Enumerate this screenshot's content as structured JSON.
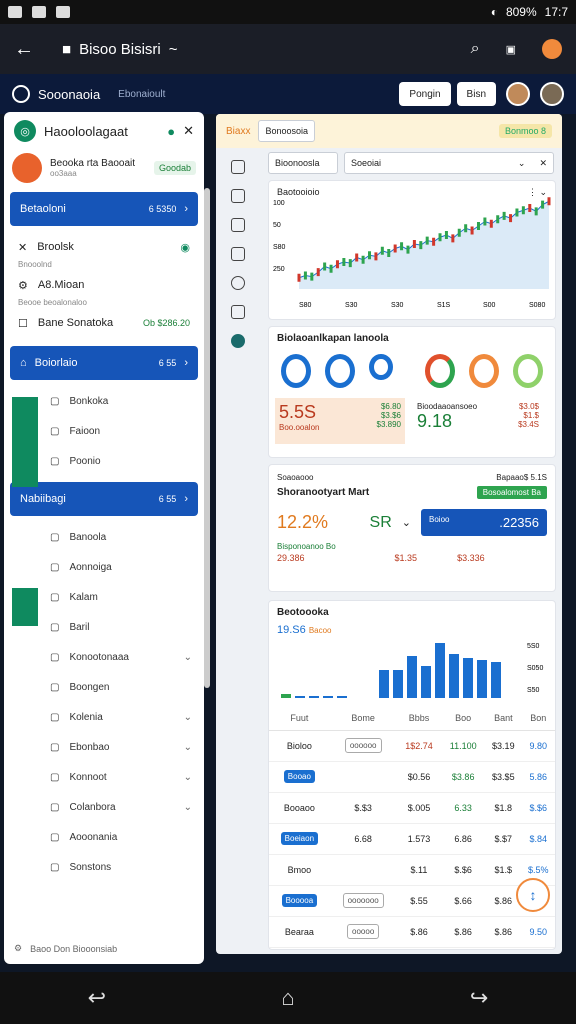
{
  "status": {
    "battery": "809%",
    "time": "17:7"
  },
  "browser": {
    "title": "Bisoo Bisisri",
    "chev": "~"
  },
  "app": {
    "brand": "Sooonaoia",
    "sub": "Ebonaioult",
    "btn1": "Pongin",
    "btn2": "Bisn"
  },
  "sidebar": {
    "title": "Haooloolagaat",
    "user_name": "Beooka rta Baooait",
    "user_sub": "oo3aaa",
    "user_chip": "Goodab",
    "nav1": {
      "label": "Betaoloni",
      "count": "6 5350"
    },
    "item_a": "Broolsk",
    "item_a_sub": "Bnooolnd",
    "item_b": "A8.Mioan",
    "item_b_sub": "Beooe beoalonaloo",
    "item_c": "Bane Sonatoka",
    "item_c_val": "Ob $286.20",
    "nav2": {
      "label": "Boiorlaio",
      "count": "6 55"
    },
    "sub1": [
      "Bonkoka",
      "Faioon",
      "Poonio"
    ],
    "nav3": {
      "label": "Nabiibagi",
      "count": "6 55"
    },
    "sub2": [
      "Banoola",
      "Aonnoiga",
      "Kalam",
      "Baril",
      "Konootonaaa",
      "Boongen",
      "Kolenia",
      "Ebonbao",
      "Konnoot",
      "Colanbora",
      "Aooonania",
      "Sonstons"
    ],
    "foot": "Baoo Don Biooonsiab"
  },
  "main": {
    "strip_left": "Biaxx",
    "strip_mid": "Bonoosoia",
    "strip_badge": "Bonmoo 8",
    "input1": "Bioonoosla",
    "input2": "Soeoiai",
    "chart1": {
      "title": "Baotooioio",
      "ylabels": [
        "100",
        "50",
        "S80",
        "250"
      ],
      "xlabels": [
        "S80",
        "S30",
        "S30",
        "S1S",
        "S00",
        "S080"
      ]
    },
    "card2": {
      "title": "Biolaoanlkapan lanoola",
      "big1": "5.5S",
      "r1a": "$6.80",
      "r1b": "$3.$6",
      "r1c": "$3.890",
      "big2": "9.18",
      "r2a": "$3.0$",
      "r2b": "$1.$",
      "r2c": "$3.4S",
      "sub1": "Boo.ooalon",
      "sub2": "Bioodaaoansoeo"
    },
    "card3": {
      "top_left": "Soaoaooo",
      "top_right": "Bapaao$ 5.1S",
      "title": "Shoranootyart Mart",
      "pct": "12.2%",
      "mid": "SR",
      "btn": ".22356",
      "btn_label": "Boioo",
      "green": "Bisponoanoo Bo",
      "row_vals": [
        "29.386",
        "$1.35",
        "$3.336"
      ],
      "badge": "Bosoalomost Ba"
    },
    "card4": {
      "title": "Beotoooka",
      "val": "19.S6",
      "sub": "Bacoo",
      "ylabels": [
        "5S0",
        "S050",
        "S50"
      ]
    },
    "table": {
      "headers": [
        "Fuut",
        "Bome",
        "Bbbs",
        "Boo",
        "Bant",
        "Bon"
      ],
      "rows": [
        [
          "Bioloo",
          "oooooo",
          "1$2.74",
          "11.100",
          "$3.19",
          "9.80"
        ],
        [
          "Booao",
          "",
          "$0.56",
          "$3.86",
          "$3.$5",
          "5.86"
        ],
        [
          "Booaoo",
          "$.$3",
          "$.005",
          "6.33",
          "$1.8",
          "$.$6"
        ],
        [
          "Boeiaon",
          "6.68",
          "1.573",
          "6.86",
          "$.$7",
          "$.84"
        ],
        [
          "Bmoo",
          "",
          "$.11",
          "$.$6",
          "$1.$",
          "$.5%"
        ],
        [
          "Booooa",
          "ooooooo",
          "$.55",
          "$.66",
          "$.86",
          "5.56"
        ],
        [
          "Bearaa",
          "ooooo",
          "$.86",
          "$.86",
          "$.86",
          "9.50"
        ]
      ]
    }
  },
  "chart_data": {
    "type": "line",
    "title": "Baotooioio",
    "values": [
      60,
      62,
      61,
      65,
      70,
      68,
      72,
      74,
      73,
      78,
      76,
      80,
      79,
      84,
      82,
      86,
      88,
      85,
      90,
      89,
      93,
      92,
      96,
      98,
      95,
      100,
      104,
      102,
      106,
      110,
      108,
      112,
      115,
      113,
      118,
      120,
      122,
      119,
      125,
      128
    ]
  }
}
